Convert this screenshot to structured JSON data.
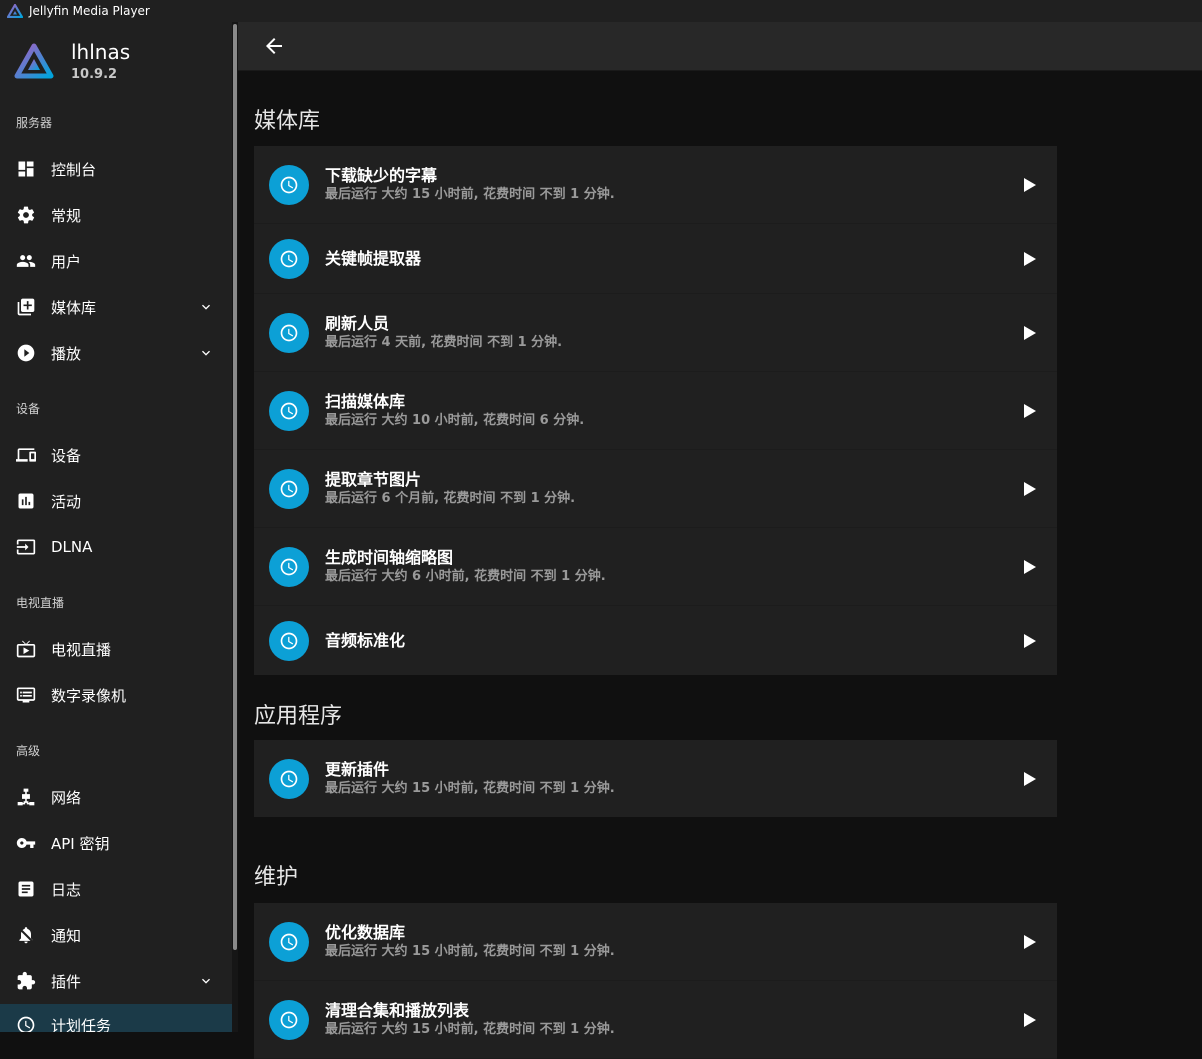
{
  "window": {
    "title": "Jellyfin Media Player"
  },
  "server": {
    "name": "lhlnas",
    "version": "10.9.2"
  },
  "sidebar": {
    "sections": [
      {
        "label": "服务器"
      },
      {
        "label": "设备"
      },
      {
        "label": "电视直播"
      },
      {
        "label": "高级"
      }
    ],
    "items": [
      {
        "label": "控制台",
        "icon": "dashboard-icon"
      },
      {
        "label": "常规",
        "icon": "gear-icon"
      },
      {
        "label": "用户",
        "icon": "users-icon"
      },
      {
        "label": "媒体库",
        "icon": "library-add-icon"
      },
      {
        "label": "播放",
        "icon": "play-circle-icon"
      },
      {
        "label": "设备",
        "icon": "devices-icon"
      },
      {
        "label": "活动",
        "icon": "activity-icon"
      },
      {
        "label": "DLNA",
        "icon": "input-icon"
      },
      {
        "label": "电视直播",
        "icon": "live-tv-icon"
      },
      {
        "label": "数字录像机",
        "icon": "dvr-icon"
      },
      {
        "label": "网络",
        "icon": "network-icon"
      },
      {
        "label": "API 密钥",
        "icon": "key-icon"
      },
      {
        "label": "日志",
        "icon": "log-icon"
      },
      {
        "label": "通知",
        "icon": "notification-icon"
      },
      {
        "label": "插件",
        "icon": "puzzle-icon"
      },
      {
        "label": "计划任务",
        "icon": "clock-icon"
      }
    ]
  },
  "groups": [
    {
      "title": "媒体库",
      "tasks": [
        {
          "name": "下载缺少的字幕",
          "status": "最后运行 大约 15 小时前, 花费时间 不到 1 分钟."
        },
        {
          "name": "关键帧提取器",
          "status": ""
        },
        {
          "name": "刷新人员",
          "status": "最后运行 4 天前, 花费时间 不到 1 分钟."
        },
        {
          "name": "扫描媒体库",
          "status": "最后运行 大约 10 小时前, 花费时间 6 分钟."
        },
        {
          "name": "提取章节图片",
          "status": "最后运行 6 个月前, 花费时间 不到 1 分钟."
        },
        {
          "name": "生成时间轴缩略图",
          "status": "最后运行 大约 6 小时前, 花费时间 不到 1 分钟."
        },
        {
          "name": "音频标准化",
          "status": ""
        }
      ]
    },
    {
      "title": "应用程序",
      "tasks": [
        {
          "name": "更新插件",
          "status": "最后运行 大约 15 小时前, 花费时间 不到 1 分钟."
        }
      ]
    },
    {
      "title": "维护",
      "tasks": [
        {
          "name": "优化数据库",
          "status": "最后运行 大约 15 小时前, 花费时间 不到 1 分钟."
        },
        {
          "name": "清理合集和播放列表",
          "status": "最后运行 大约 15 小时前, 花费时间 不到 1 分钟."
        }
      ]
    }
  ],
  "colors": {
    "accent": "#00a4dc",
    "active_bg": "#1b3a48",
    "surface": "#202020",
    "background": "#101010"
  }
}
